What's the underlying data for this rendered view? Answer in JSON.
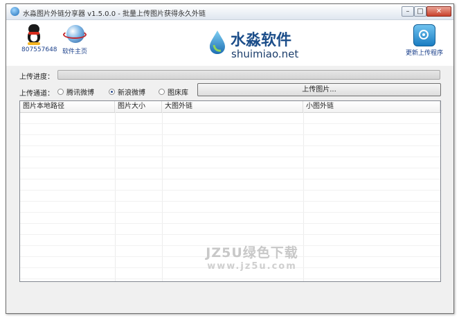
{
  "window": {
    "title": "水淼图片外链分享器 v1.5.0.0 - 批量上传图片获得永久外链"
  },
  "titlebar_buttons": {
    "minimize": "–",
    "maximize": "□",
    "close": "✕"
  },
  "header": {
    "qq": {
      "label": "807557648",
      "icon": "qq-penguin-icon"
    },
    "website": {
      "label": "软件主页",
      "icon": "globe-icon"
    },
    "logo": {
      "cn": "水淼软件",
      "en": "shuimiao.net"
    },
    "update": {
      "label": "更新上传程序",
      "icon": "update-icon"
    }
  },
  "upload": {
    "progress_label": "上传进度：",
    "progress_value": 0,
    "channel_label": "上传通道：",
    "channels": [
      {
        "label": "腾讯微博",
        "selected": false
      },
      {
        "label": "新浪微博",
        "selected": true
      },
      {
        "label": "图床库",
        "selected": false
      }
    ],
    "button_label": "上传图片..."
  },
  "table": {
    "columns": [
      "图片本地路径",
      "图片大小",
      "大图外链",
      "小图外链"
    ],
    "rows": []
  },
  "watermark": {
    "line1": "JZ5U绿色下载",
    "line2": "www.jz5u.com"
  }
}
